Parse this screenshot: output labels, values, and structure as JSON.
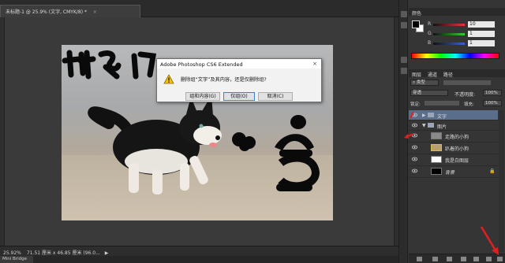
{
  "document": {
    "tab_title": "未标题-1 @ 25.9% (文字, CMYK/8) *",
    "tab_close": "×"
  },
  "dialog": {
    "title": "Adobe Photoshop CS6 Extended",
    "close": "×",
    "message": "删除组“文字”及其内容，还是仅删除组?",
    "buttons": {
      "merge": "组和内容(G)",
      "delete_group_only": "仅组(O)",
      "cancel": "取消(C)"
    }
  },
  "statusbar": {
    "zoom": "25.92%",
    "info": "71.51 厘米 x 46.85 厘米 (96.0...",
    "next_icon": "▶"
  },
  "bottom_tabs": {
    "mini_bridge": "Mini Bridge"
  },
  "color_panel": {
    "title": "颜色",
    "channels": [
      {
        "label": "R",
        "value": "10",
        "color": "#e33"
      },
      {
        "label": "G",
        "value": "1",
        "color": "#3c3"
      },
      {
        "label": "B",
        "value": "1",
        "color": "#36c"
      }
    ]
  },
  "layers_panel": {
    "tabs": [
      "图层",
      "通道",
      "路径"
    ],
    "kind_label": "类型",
    "blend_mode": "穿透",
    "opacity_label": "不透明度:",
    "opacity_value": "100%",
    "lock_label": "锁定:",
    "fill_label": "填充:",
    "fill_value": "100%",
    "layers": [
      {
        "name": "文字",
        "kind": "group",
        "selected": true
      },
      {
        "name": "图片",
        "kind": "group",
        "selected": false
      },
      {
        "name": "走路的小狗",
        "kind": "pixel",
        "selected": false
      },
      {
        "name": "趴着的小狗",
        "kind": "pixel",
        "selected": false
      },
      {
        "name": "我是白图层",
        "kind": "fill-white",
        "selected": false
      },
      {
        "name": "背景",
        "kind": "fill-black",
        "selected": false
      }
    ]
  },
  "accent": {
    "red_arrow": "#e02020",
    "selection": "#5a6e8c"
  }
}
